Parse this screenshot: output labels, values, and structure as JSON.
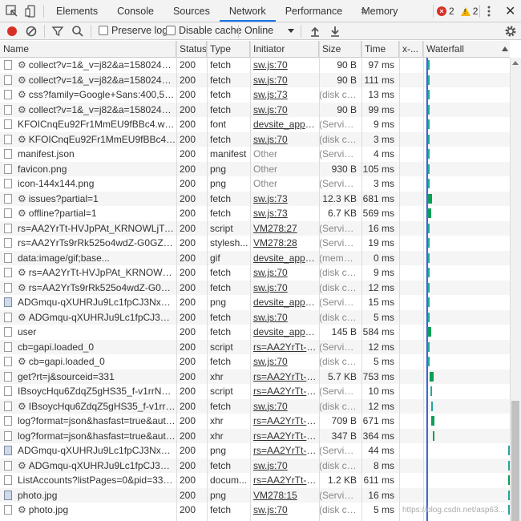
{
  "tabs": [
    {
      "label": "Elements"
    },
    {
      "label": "Console"
    },
    {
      "label": "Sources"
    },
    {
      "label": "Network",
      "active": true
    },
    {
      "label": "Performance"
    },
    {
      "label": "Memory"
    }
  ],
  "more_label": "»",
  "errors": {
    "error_count": "2",
    "warning_count": "2",
    "error_color": "#d93025",
    "warning_color": "#f4b400"
  },
  "toolbar": {
    "preserve_log": "Preserve log",
    "disable_cache": "Disable cache",
    "throttle": "Online"
  },
  "columns": [
    "Name",
    "Status",
    "Type",
    "Initiator",
    "Size",
    "Time",
    "x-...",
    "Waterfall"
  ],
  "rows": [
    {
      "name": "collect?v=1&_v=j82&a=1580248316...",
      "gear": true,
      "status": "200",
      "type": "fetch",
      "initiator": "sw.js:70",
      "ilink": true,
      "size": "90 B",
      "time": "97 ms"
    },
    {
      "name": "collect?v=1&_v=j82&a=1580248316...",
      "gear": true,
      "status": "200",
      "type": "fetch",
      "initiator": "sw.js:70",
      "ilink": true,
      "size": "90 B",
      "time": "111 ms"
    },
    {
      "name": "css?family=Google+Sans:400,500|Ro...",
      "gear": true,
      "status": "200",
      "type": "fetch",
      "initiator": "sw.js:73",
      "ilink": true,
      "size": "(disk ca...",
      "time": "13 ms"
    },
    {
      "name": "collect?v=1&_v=j82&a=1580248316...",
      "gear": true,
      "status": "200",
      "type": "fetch",
      "initiator": "sw.js:70",
      "ilink": true,
      "size": "90 B",
      "time": "99 ms"
    },
    {
      "name": "KFOICnqEu92Fr1MmEU9fBBc4.woff2",
      "gear": false,
      "status": "200",
      "type": "font",
      "initiator": "devsite_app__z...",
      "ilink": true,
      "size": "(Service...",
      "time": "9 ms"
    },
    {
      "name": "KFOICnqEu92Fr1MmEU9fBBc4.woff2",
      "gear": true,
      "status": "200",
      "type": "fetch",
      "initiator": "sw.js:70",
      "ilink": true,
      "size": "(disk ca...",
      "time": "3 ms"
    },
    {
      "name": "manifest.json",
      "gear": false,
      "status": "200",
      "type": "manifest",
      "initiator": "Other",
      "ilink": false,
      "size": "(Service...",
      "time": "4 ms"
    },
    {
      "name": "favicon.png",
      "gear": false,
      "status": "200",
      "type": "png",
      "initiator": "Other",
      "ilink": false,
      "size": "930 B",
      "time": "105 ms"
    },
    {
      "name": "icon-144x144.png",
      "gear": false,
      "status": "200",
      "type": "png",
      "initiator": "Other",
      "ilink": false,
      "size": "(Service...",
      "time": "3 ms"
    },
    {
      "name": "issues?partial=1",
      "gear": true,
      "status": "200",
      "type": "fetch",
      "initiator": "sw.js:73",
      "ilink": true,
      "size": "12.3 KB",
      "time": "681 ms"
    },
    {
      "name": "offline?partial=1",
      "gear": true,
      "status": "200",
      "type": "fetch",
      "initiator": "sw.js:73",
      "ilink": true,
      "size": "6.7 KB",
      "time": "569 ms"
    },
    {
      "name": "rs=AA2YrTt-HVJpPAt_KRNOWLjT-5w7T...",
      "gear": false,
      "status": "200",
      "type": "script",
      "initiator": "VM278:27",
      "ilink": true,
      "size": "(Service...",
      "time": "16 ms"
    },
    {
      "name": "rs=AA2YrTs9rRk525o4wdZ-G0GZSqge-...",
      "gear": false,
      "status": "200",
      "type": "stylesh...",
      "initiator": "VM278:28",
      "ilink": true,
      "size": "(Service...",
      "time": "19 ms"
    },
    {
      "name": "data:image/gif;base...",
      "gear": false,
      "status": "200",
      "type": "gif",
      "initiator": "devsite_app__z...",
      "ilink": true,
      "size": "(memo...",
      "time": "0 ms"
    },
    {
      "name": "rs=AA2YrTt-HVJpPAt_KRNOWLjT-5w7T...",
      "gear": true,
      "status": "200",
      "type": "fetch",
      "initiator": "sw.js:70",
      "ilink": true,
      "size": "(disk ca...",
      "time": "9 ms"
    },
    {
      "name": "rs=AA2YrTs9rRk525o4wdZ-G0GZSqg...",
      "gear": true,
      "status": "200",
      "type": "fetch",
      "initiator": "sw.js:70",
      "ilink": true,
      "size": "(disk ca...",
      "time": "12 ms"
    },
    {
      "name": "ADGmqu-qXUHRJu9Lc1fpCJ3NxPeFLp...",
      "gear": false,
      "img": true,
      "status": "200",
      "type": "png",
      "initiator": "devsite_app__z...",
      "ilink": true,
      "size": "(Service...",
      "time": "15 ms"
    },
    {
      "name": "ADGmqu-qXUHRJu9Lc1fpCJ3NxPeFL...",
      "gear": true,
      "status": "200",
      "type": "fetch",
      "initiator": "sw.js:70",
      "ilink": true,
      "size": "(disk ca...",
      "time": "5 ms"
    },
    {
      "name": "user",
      "gear": false,
      "status": "200",
      "type": "fetch",
      "initiator": "devsite_app__z...",
      "ilink": true,
      "size": "145 B",
      "time": "584 ms"
    },
    {
      "name": "cb=gapi.loaded_0",
      "gear": false,
      "status": "200",
      "type": "script",
      "initiator": "rs=AA2YrTt-H...",
      "ilink": true,
      "size": "(Service...",
      "time": "12 ms"
    },
    {
      "name": "cb=gapi.loaded_0",
      "gear": true,
      "status": "200",
      "type": "fetch",
      "initiator": "sw.js:70",
      "ilink": true,
      "size": "(disk ca...",
      "time": "5 ms"
    },
    {
      "name": "get?rt=j&sourceid=331",
      "gear": false,
      "status": "200",
      "type": "xhr",
      "initiator": "rs=AA2YrTt-H...",
      "ilink": true,
      "size": "5.7 KB",
      "time": "753 ms"
    },
    {
      "name": "IBsoycHqu6ZdqZ5gHS35_f-v1rrNoj4t1c...",
      "gear": false,
      "status": "200",
      "type": "script",
      "initiator": "rs=AA2YrTt-H...",
      "ilink": true,
      "size": "(Service...",
      "time": "10 ms"
    },
    {
      "name": "IBsoycHqu6ZdqZ5gHS35_f-v1rrNoj4t...",
      "gear": true,
      "status": "200",
      "type": "fetch",
      "initiator": "sw.js:70",
      "ilink": true,
      "size": "(disk ca...",
      "time": "12 ms"
    },
    {
      "name": "log?format=json&hasfast=true&authus...",
      "gear": false,
      "status": "200",
      "type": "xhr",
      "initiator": "rs=AA2YrTt-H...",
      "ilink": true,
      "size": "709 B",
      "time": "671 ms"
    },
    {
      "name": "log?format=json&hasfast=true&authus...",
      "gear": false,
      "status": "200",
      "type": "xhr",
      "initiator": "rs=AA2YrTt-H...",
      "ilink": true,
      "size": "347 B",
      "time": "364 ms"
    },
    {
      "name": "ADGmqu-qXUHRJu9Lc1fpCJ3NxPeFLp...",
      "gear": false,
      "img": true,
      "status": "200",
      "type": "png",
      "initiator": "rs=AA2YrTt-H...",
      "ilink": true,
      "size": "(Service...",
      "time": "44 ms"
    },
    {
      "name": "ADGmqu-qXUHRJu9Lc1fpCJ3NxPeFL...",
      "gear": true,
      "status": "200",
      "type": "fetch",
      "initiator": "sw.js:70",
      "ilink": true,
      "size": "(disk ca...",
      "time": "8 ms"
    },
    {
      "name": "ListAccounts?listPages=0&pid=331&g...",
      "gear": false,
      "status": "200",
      "type": "docum...",
      "initiator": "rs=AA2YrTt-H...",
      "ilink": true,
      "size": "1.2 KB",
      "time": "611 ms"
    },
    {
      "name": "photo.jpg",
      "gear": false,
      "img": true,
      "status": "200",
      "type": "png",
      "initiator": "VM278:15",
      "ilink": true,
      "size": "(Service...",
      "time": "16 ms"
    },
    {
      "name": "photo.jpg",
      "gear": true,
      "status": "200",
      "type": "fetch",
      "initiator": "sw.js:70",
      "ilink": true,
      "size": "(disk ca...",
      "time": "5 ms"
    }
  ],
  "watermark": "https://blog.csdn.net/asp63..."
}
